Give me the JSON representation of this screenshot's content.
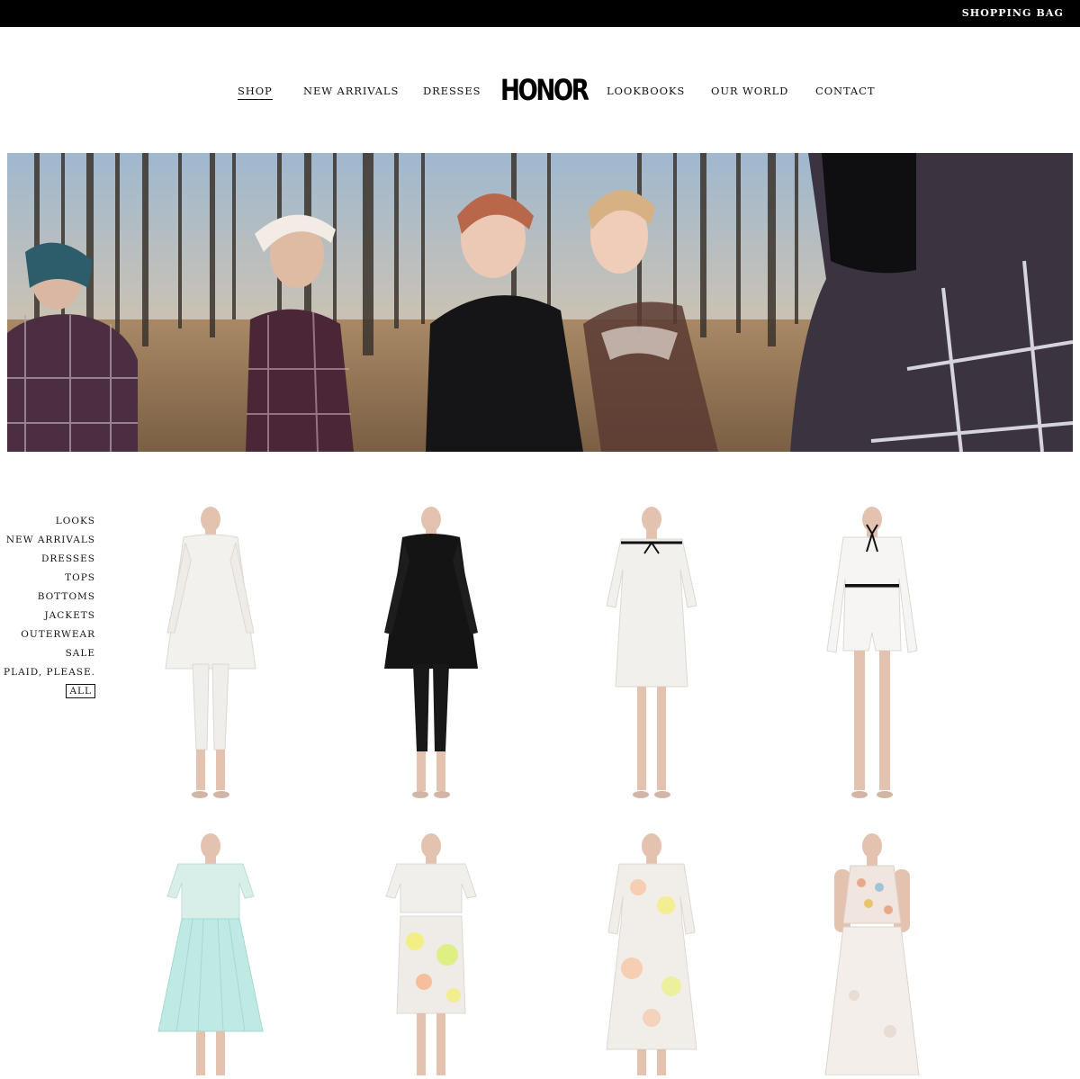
{
  "topbar": {
    "shopping_bag": "SHOPPING BAG"
  },
  "brand": {
    "logo": "HONOR"
  },
  "nav": {
    "left": [
      "SHOP",
      "NEW ARRIVALS",
      "DRESSES"
    ],
    "right": [
      "LOOKBOOKS",
      "OUR WORLD",
      "CONTACT"
    ],
    "active": "SHOP"
  },
  "hero": {
    "description": "Forest lookbook photo with five models in plaid, black and sheer outfits"
  },
  "categories": {
    "items": [
      "LOOKS",
      "NEW ARRIVALS",
      "DRESSES",
      "TOPS",
      "BOTTOMS",
      "JACKETS",
      "OUTERWEAR",
      "SALE",
      "PLAID, PLEASE.",
      "ALL"
    ],
    "selected": "ALL"
  },
  "products": [
    {
      "kind": "white-lace-coat-set",
      "colors": {
        "main": "#f3f1ee",
        "accent": "#e6e2dc"
      }
    },
    {
      "kind": "black-lace-coat-set",
      "colors": {
        "main": "#141414",
        "accent": "#2c2c2c"
      }
    },
    {
      "kind": "white-lace-dress-ribbon",
      "colors": {
        "main": "#f2f0ec",
        "accent": "#111111"
      }
    },
    {
      "kind": "white-shirt-romper-ribbon",
      "colors": {
        "main": "#f6f5f3",
        "accent": "#111111"
      }
    },
    {
      "kind": "mint-pleated-dress",
      "colors": {
        "main": "#bfeae3",
        "accent": "#e8f4f2"
      }
    },
    {
      "kind": "floral-top-skirt",
      "colors": {
        "main": "#efece8",
        "accent": "#f3ee7a"
      }
    },
    {
      "kind": "floral-organza-dress",
      "colors": {
        "main": "#f1eeea",
        "accent": "#f6c6a6"
      }
    },
    {
      "kind": "embellished-halter-top-pants",
      "colors": {
        "main": "#f0e6df",
        "accent": "#e8a98a"
      }
    }
  ],
  "colors": {
    "topbar": "#000000",
    "text": "#111111",
    "background": "#ffffff"
  }
}
